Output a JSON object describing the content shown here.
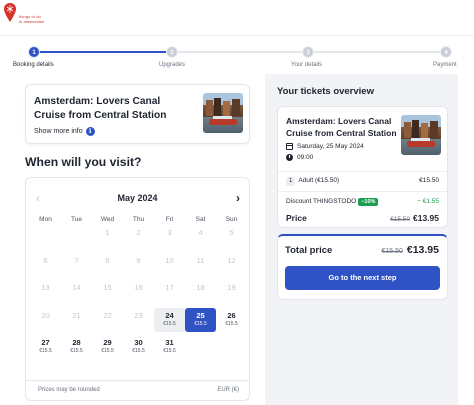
{
  "brand": {
    "logo_lines": [
      "things to do",
      "in amsterdam"
    ],
    "color": "#d8302a",
    "logo_icon": "map-pin-icon"
  },
  "steps": [
    {
      "number": "1",
      "label": "Booking details",
      "active": true
    },
    {
      "number": "2",
      "label": "Upgrades",
      "active": false
    },
    {
      "number": "3",
      "label": "Your details",
      "active": false
    },
    {
      "number": "4",
      "label": "Payment",
      "active": false
    }
  ],
  "tour": {
    "title": "Amsterdam: Lovers Canal Cruise from Central Station",
    "show_more": "Show more info",
    "info_icon": "i"
  },
  "visit_title": "When will you visit?",
  "calendar": {
    "month": "May 2024",
    "prev_icon": "‹",
    "next_icon": "›",
    "weekdays": [
      "Mon",
      "Tue",
      "Wed",
      "Thu",
      "Fri",
      "Sat",
      "Sun"
    ],
    "weeks": [
      [
        {
          "d": ""
        },
        {
          "d": ""
        },
        {
          "d": "1"
        },
        {
          "d": "2"
        },
        {
          "d": "3"
        },
        {
          "d": "4"
        },
        {
          "d": "5"
        }
      ],
      [
        {
          "d": "6"
        },
        {
          "d": "7"
        },
        {
          "d": "8"
        },
        {
          "d": "9"
        },
        {
          "d": "10"
        },
        {
          "d": "11"
        },
        {
          "d": "12"
        }
      ],
      [
        {
          "d": "13"
        },
        {
          "d": "14"
        },
        {
          "d": "15"
        },
        {
          "d": "16"
        },
        {
          "d": "17"
        },
        {
          "d": "18"
        },
        {
          "d": "19"
        }
      ],
      [
        {
          "d": "20"
        },
        {
          "d": "21"
        },
        {
          "d": "22"
        },
        {
          "d": "23"
        },
        {
          "d": "24",
          "p": "€15.5",
          "state": "hl"
        },
        {
          "d": "25",
          "p": "€15.5",
          "state": "sel"
        },
        {
          "d": "26",
          "p": "€15.5"
        }
      ],
      [
        {
          "d": "27",
          "p": "€15.5"
        },
        {
          "d": "28",
          "p": "€15.5"
        },
        {
          "d": "29",
          "p": "€15.5"
        },
        {
          "d": "30",
          "p": "€15.5"
        },
        {
          "d": "31",
          "p": "€15.5"
        },
        {
          "d": ""
        },
        {
          "d": ""
        }
      ]
    ],
    "footer_left": "Prices may be rounded",
    "footer_right": "EUR (€)"
  },
  "overview": {
    "title": "Your tickets overview",
    "tour_title": "Amsterdam: Lovers Canal Cruise from Central Station",
    "date": "Saturday, 25 May 2024",
    "time": "09:00",
    "ticket_qty": "1",
    "ticket_label": "Adult (€15.50)",
    "ticket_price": "€15.50",
    "discount_label": "Discount THINGSTODO",
    "discount_badge": "−10%",
    "discount_amount": "− €1.55",
    "price_label": "Price",
    "price_old": "€15.50",
    "price_new": "€13.95"
  },
  "total": {
    "label": "Total price",
    "old": "€15.50",
    "new": "€13.95",
    "button": "Go to the next step"
  },
  "colors": {
    "accent": "#2f52c4",
    "discount": "#1e9e54",
    "brand": "#d8302a"
  }
}
